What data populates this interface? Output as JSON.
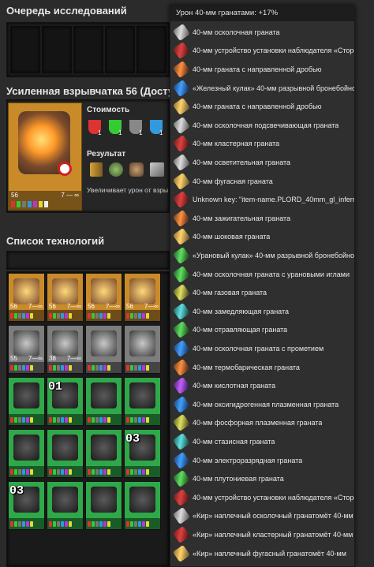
{
  "research_queue": {
    "title": "Очередь исследований"
  },
  "selected_tech": {
    "title": "Усиленная взрывчатка 56 (Доступно)",
    "level": "56",
    "level_max": "7 — ∞",
    "cost_label": "Стоимость",
    "cost_counts": [
      "1",
      "1",
      "1",
      "1"
    ],
    "result_label": "Результат",
    "description": "Увеличивает урон от взры"
  },
  "tech_list": {
    "title": "Список технологий",
    "cards": [
      {
        "lvl": "56",
        "lvl2": "7—∞",
        "color": "orange"
      },
      {
        "lvl": "56",
        "lvl2": "7—∞",
        "color": "orange"
      },
      {
        "lvl": "56",
        "lvl2": "7—∞",
        "color": "orange"
      },
      {
        "lvl": "56",
        "lvl2": "7—∞",
        "color": "orange"
      },
      {
        "lvl": "55",
        "lvl2": "7—∞",
        "color": "grey"
      },
      {
        "lvl": "38",
        "lvl2": "7—∞",
        "color": "grey"
      },
      {
        "lvl": "",
        "lvl2": "",
        "color": "grey"
      },
      {
        "lvl": "",
        "lvl2": "",
        "color": "grey"
      },
      {
        "lvl": "",
        "lvl2": "",
        "color": "green",
        "badge": ""
      },
      {
        "lvl": "",
        "lvl2": "",
        "color": "green",
        "badge": "01"
      },
      {
        "lvl": "",
        "lvl2": "",
        "color": "green"
      },
      {
        "lvl": "",
        "lvl2": "",
        "color": "green"
      },
      {
        "lvl": "",
        "lvl2": "",
        "color": "green"
      },
      {
        "lvl": "",
        "lvl2": "",
        "color": "green"
      },
      {
        "lvl": "",
        "lvl2": "",
        "color": "green"
      },
      {
        "lvl": "",
        "lvl2": "",
        "color": "green",
        "badge": "03"
      },
      {
        "lvl": "",
        "lvl2": "",
        "color": "green",
        "badge": "03"
      },
      {
        "lvl": "",
        "lvl2": "",
        "color": "green"
      },
      {
        "lvl": "",
        "lvl2": "",
        "color": "green"
      },
      {
        "lvl": "",
        "lvl2": "",
        "color": "green"
      }
    ],
    "small_counts": [
      "1",
      "1"
    ]
  },
  "tooltip": {
    "header": "Урон 40-мм гранатами: +17%",
    "rows": [
      {
        "text": "40-мм осколочная граната",
        "icon": "sh2"
      },
      {
        "text": "40-мм устройство установки наблюдателя «Сторожевой",
        "icon": "shr"
      },
      {
        "text": "40-мм граната с направленной дробью",
        "icon": "sho"
      },
      {
        "text": "«Железный кулак» 40-мм разрывной бронебойной снаря",
        "icon": "shb"
      },
      {
        "text": "40-мм граната с направленной дробью",
        "icon": "sh1"
      },
      {
        "text": "40-мм осколочная подсвечивающая граната",
        "icon": "sh2"
      },
      {
        "text": "40-мм кластерная граната",
        "icon": "shr"
      },
      {
        "text": "40-мм осветительная граната",
        "icon": "sh2"
      },
      {
        "text": "40-мм фугасная граната",
        "icon": "sh1"
      },
      {
        "text": "Unknown key: \"item-name.PLORD_40mm_gl_inferno\"",
        "icon": "shr"
      },
      {
        "text": "40-мм зажигательная граната",
        "icon": "sho"
      },
      {
        "text": "40-мм шоковая граната",
        "icon": "sh1"
      },
      {
        "text": "«Урановый кулак» 40-мм разрывной бронебойной снаря",
        "icon": "shg"
      },
      {
        "text": "40-мм осколочная граната с урановыми иглами",
        "icon": "shg"
      },
      {
        "text": "40-мм газовая граната",
        "icon": "shy"
      },
      {
        "text": "40-мм замедляющая граната",
        "icon": "shc"
      },
      {
        "text": "40-мм отравляющая граната",
        "icon": "shg"
      },
      {
        "text": "40-мм осколочная граната с прометием",
        "icon": "shb"
      },
      {
        "text": "40-мм термобарическая граната",
        "icon": "sho"
      },
      {
        "text": "40-мм кислотная граната",
        "icon": "shp"
      },
      {
        "text": "40-мм оксигидрогенная плазменная граната",
        "icon": "shb"
      },
      {
        "text": "40-мм фосфорная плазменная граната",
        "icon": "shy"
      },
      {
        "text": "40-мм стазисная граната",
        "icon": "shc"
      },
      {
        "text": "40-мм электроразрядная граната",
        "icon": "shb"
      },
      {
        "text": "40-мм плутониевая граната",
        "icon": "shg"
      },
      {
        "text": "40-мм устройство установки наблюдателя «Сторожевой",
        "icon": "shr"
      },
      {
        "text": "«Кир» наплечный осколочный гранатомёт 40-мм",
        "icon": "sh2"
      },
      {
        "text": "«Кир» наплечный кластерный гранатомёт 40-мм",
        "icon": "shr"
      },
      {
        "text": "«Кир» наплечный фугасный гранатомёт 40-мм",
        "icon": "sh1"
      }
    ]
  }
}
